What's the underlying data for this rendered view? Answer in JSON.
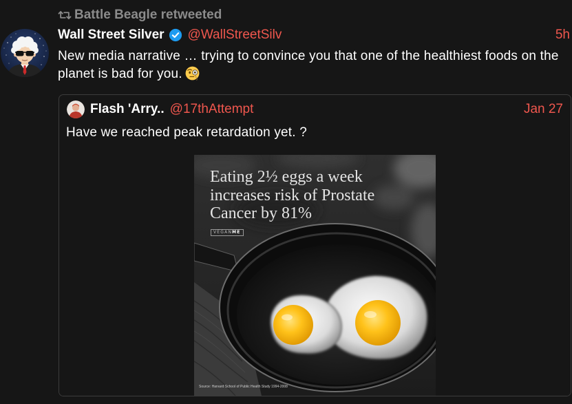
{
  "retweet_banner": {
    "icon": "retweet-icon",
    "text": "Battle Beagle retweeted"
  },
  "tweet": {
    "display_name": "Wall Street Silver",
    "verified_icon": "verified-badge-icon",
    "handle": "@WallStreetSilv",
    "time": "5h",
    "text": "New media narrative … trying to convince you that one of the healthiest foods on the planet is bad for you.",
    "emoji_icon": "face-with-monocle-icon"
  },
  "quoted_tweet": {
    "display_name": "Flash 'Arry..",
    "handle": "@17thAttempt",
    "date": "Jan 27",
    "text": "Have we reached peak retardation yet. ?",
    "media": {
      "headline_lines": [
        "Eating 2½ eggs a week",
        "increases risk of Prostate",
        "Cancer by 81%"
      ],
      "logo_part_a": "VEGAN",
      "logo_part_b": "ME",
      "source": "Source: Harvard School of Public Health Study 1994-2008"
    }
  },
  "colors": {
    "background": "#161616",
    "text": "#ffffff",
    "muted": "#8b8b8b",
    "accent": "#f0574e",
    "verified": "#1d9bf0",
    "border": "#3c3c3c"
  }
}
